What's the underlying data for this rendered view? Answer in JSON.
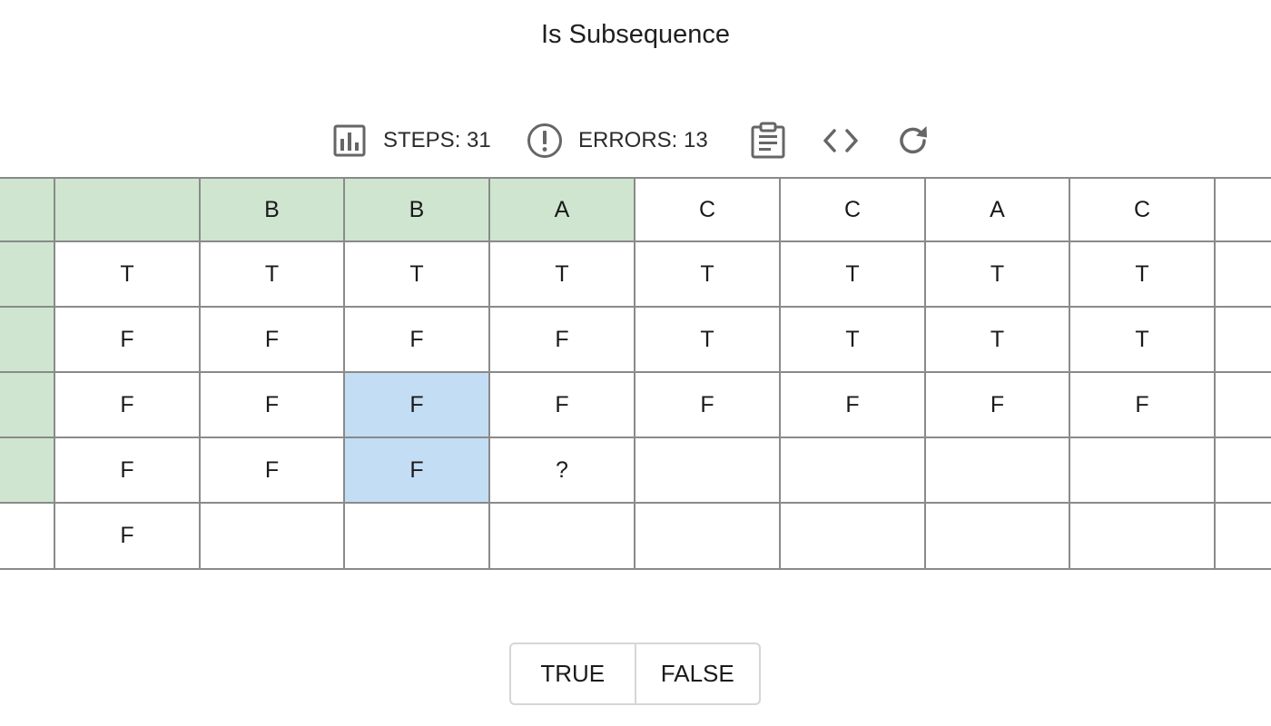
{
  "title": "Is Subsequence",
  "toolbar": {
    "steps_label": "STEPS: 31",
    "errors_label": "ERRORS: 13",
    "icons": [
      "bar-chart-icon",
      "exclamation-circle-icon",
      "clipboard-icon",
      "code-icon",
      "refresh-icon"
    ]
  },
  "grid": {
    "header": [
      "",
      "",
      "B",
      "B",
      "A",
      "C",
      "C",
      "A",
      "C",
      ""
    ],
    "rows": [
      [
        "",
        "T",
        "T",
        "T",
        "T",
        "T",
        "T",
        "T",
        "T",
        ""
      ],
      [
        "",
        "F",
        "F",
        "F",
        "F",
        "T",
        "T",
        "T",
        "T",
        ""
      ],
      [
        "",
        "F",
        "F",
        "F",
        "F",
        "F",
        "F",
        "F",
        "F",
        ""
      ],
      [
        "",
        "F",
        "F",
        "F",
        "?",
        "",
        "",
        "",
        "",
        ""
      ],
      [
        "",
        "F",
        "",
        "",
        "",
        "",
        "",
        "",
        "",
        ""
      ]
    ],
    "highlighted_green": [
      [
        0,
        0
      ],
      [
        0,
        1
      ],
      [
        0,
        2
      ],
      [
        0,
        3
      ],
      [
        0,
        4
      ],
      [
        1,
        0
      ],
      [
        2,
        0
      ],
      [
        3,
        0
      ],
      [
        4,
        0
      ]
    ],
    "highlighted_blue": [
      [
        3,
        3
      ],
      [
        4,
        3
      ]
    ],
    "colors": {
      "green": "#cfe5cf",
      "blue": "#c3ddf5",
      "border": "#8a8a8a"
    }
  },
  "answer": {
    "true_label": "TRUE",
    "false_label": "FALSE"
  }
}
